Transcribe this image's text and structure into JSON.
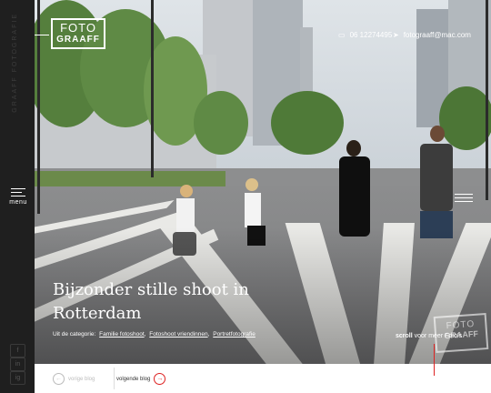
{
  "brand": {
    "logo_line1": "FOTO",
    "logo_line2": "GRAAFF"
  },
  "sidebar": {
    "vertical_text": "GRAAFF FOTOGRAFIE",
    "menu_label": "menu",
    "social": [
      "f",
      "in",
      "ig"
    ]
  },
  "header": {
    "phone": "06 12274495",
    "email": "fotograaff@mac.com"
  },
  "hero": {
    "title": "Bijzonder stille shoot in Rotterdam",
    "category_prefix": "Uit de categorie:",
    "categories": [
      "Familie fotoshoot",
      "Fotoshoot vriendinnen",
      "Portretfotografie"
    ],
    "scroll_bold": "scroll",
    "scroll_rest": "voor meer Foto's"
  },
  "watermark": {
    "line1": "FOTO",
    "line2": "GRAAFF"
  },
  "bottom_nav": {
    "prev_label": "vorige blog",
    "next_label": "volgende blog",
    "prev_arrow": "←",
    "next_arrow": "→"
  },
  "icons": {
    "phone": "phone-icon",
    "email": "send-icon"
  },
  "colors": {
    "accent": "#dd2222",
    "sidebar": "#1f1f1f"
  }
}
